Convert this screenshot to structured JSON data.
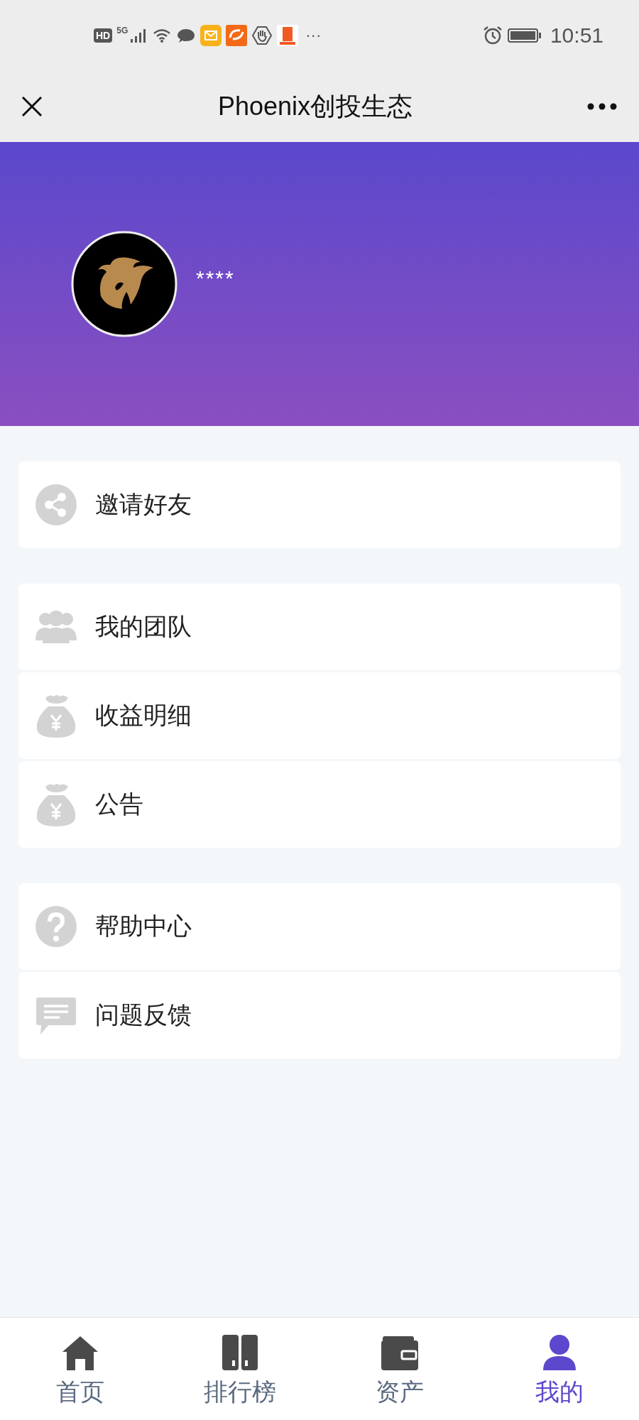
{
  "status_bar": {
    "network_badge": "HD",
    "signal_label": "5G",
    "more": "···",
    "time": "10:51"
  },
  "title_bar": {
    "title": "Phoenix创投生态"
  },
  "profile": {
    "name": "****"
  },
  "menu_groups": [
    {
      "items": [
        {
          "kind": "share",
          "label": "邀请好友"
        }
      ]
    },
    {
      "items": [
        {
          "kind": "team",
          "label": "我的团队"
        },
        {
          "kind": "money",
          "label": "收益明细"
        },
        {
          "kind": "money",
          "label": "公告"
        }
      ]
    },
    {
      "items": [
        {
          "kind": "help",
          "label": "帮助中心"
        },
        {
          "kind": "feedback",
          "label": "问题反馈"
        }
      ]
    }
  ],
  "tab_bar": [
    {
      "kind": "home",
      "label": "首页",
      "selected": false
    },
    {
      "kind": "ranking",
      "label": "排行榜",
      "selected": false
    },
    {
      "kind": "wallet",
      "label": "资产",
      "selected": false
    },
    {
      "kind": "user",
      "label": "我的",
      "selected": true
    }
  ]
}
